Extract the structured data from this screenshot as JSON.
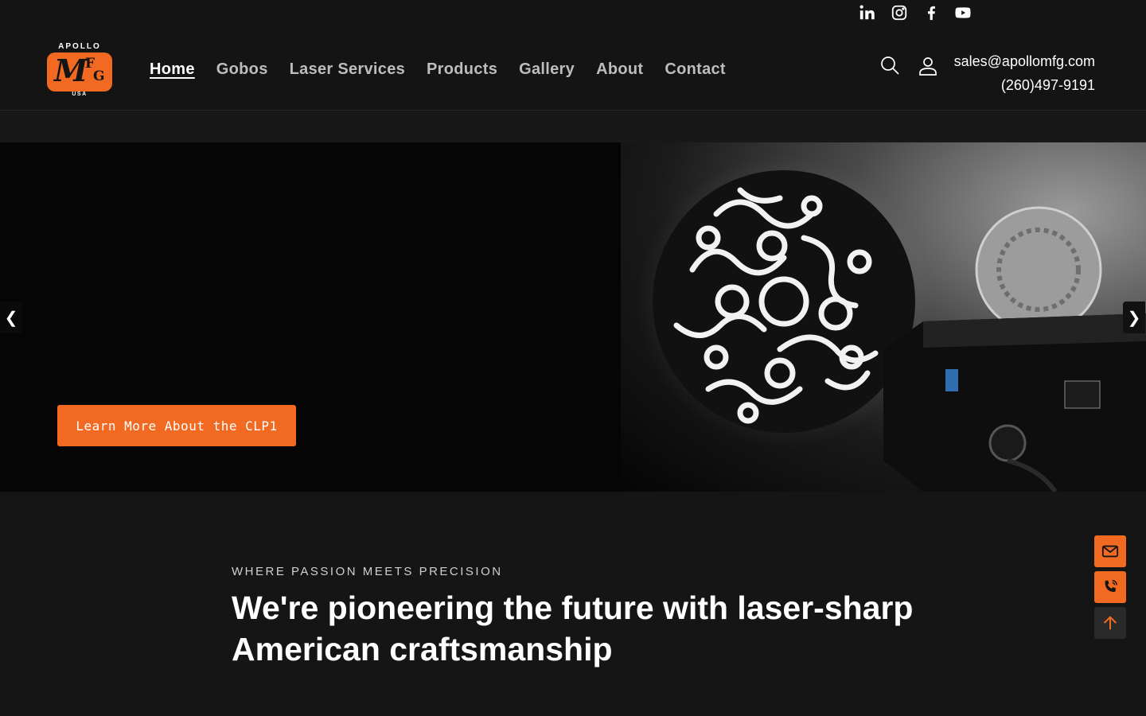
{
  "header": {
    "logo": {
      "top_text": "APOLLO",
      "mark_m": "M",
      "mark_f": "F",
      "mark_g": "G",
      "bottom_text": "USA"
    },
    "nav": [
      {
        "label": "Home",
        "active": true
      },
      {
        "label": "Gobos"
      },
      {
        "label": "Laser Services"
      },
      {
        "label": "Products"
      },
      {
        "label": "Gallery"
      },
      {
        "label": "About"
      },
      {
        "label": "Contact"
      }
    ],
    "email": "sales@apollomfg.com",
    "phone": "(260)497-9191",
    "social_icons": [
      "linkedin-icon",
      "instagram-icon",
      "facebook-icon",
      "youtube-icon"
    ]
  },
  "hero": {
    "cta_label": "Learn More About the CLP1",
    "prev_arrow": "❮",
    "next_arrow": "❯"
  },
  "intro": {
    "eyebrow": "WHERE PASSION MEETS PRECISION",
    "headline": "We're pioneering the future with laser-sharp American craftsmanship"
  },
  "colors": {
    "accent": "#f26a21",
    "background": "#151515",
    "hero_bg": "#050505"
  }
}
